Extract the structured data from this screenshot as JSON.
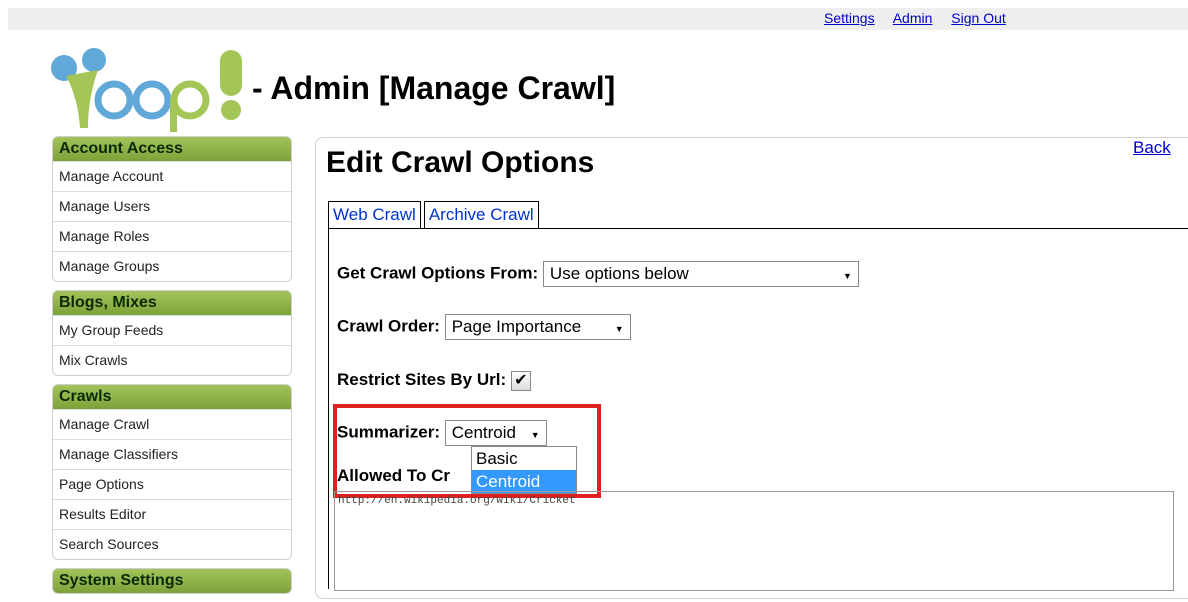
{
  "top_links": [
    "Settings",
    "Admin",
    "Sign Out"
  ],
  "logo_text": "Yioop!",
  "page_heading": "- Admin [Manage Crawl]",
  "sidebar": {
    "groups": [
      {
        "title": "Account Access",
        "items": [
          "Manage Account",
          "Manage Users",
          "Manage Roles",
          "Manage Groups"
        ]
      },
      {
        "title": "Blogs, Mixes",
        "items": [
          "My Group Feeds",
          "Mix Crawls"
        ]
      },
      {
        "title": "Crawls",
        "items": [
          "Manage Crawl",
          "Manage Classifiers",
          "Page Options",
          "Results Editor",
          "Search Sources"
        ]
      },
      {
        "title": "System Settings",
        "items": []
      }
    ]
  },
  "main": {
    "back_label": "Back",
    "title": "Edit Crawl Options",
    "tabs": [
      "Web Crawl",
      "Archive Crawl"
    ],
    "options_from_label": "Get Crawl Options From:",
    "options_from_value": "Use options below",
    "crawl_order_label": "Crawl Order:",
    "crawl_order_value": "Page Importance",
    "restrict_label": "Restrict Sites By Url:",
    "restrict_checked": true,
    "summarizer_label": "Summarizer:",
    "summarizer_value": "Centroid",
    "summarizer_options": [
      "Basic",
      "Centroid"
    ],
    "allowed_label": "Allowed To Cr",
    "allowed_text": "http://en.wikipedia.org/wiki/Cricket"
  },
  "colors": {
    "sidebar_header": "#8fb444",
    "link": "#0000cc",
    "highlight": "#e02020",
    "dropdown_selected": "#3399ff"
  }
}
